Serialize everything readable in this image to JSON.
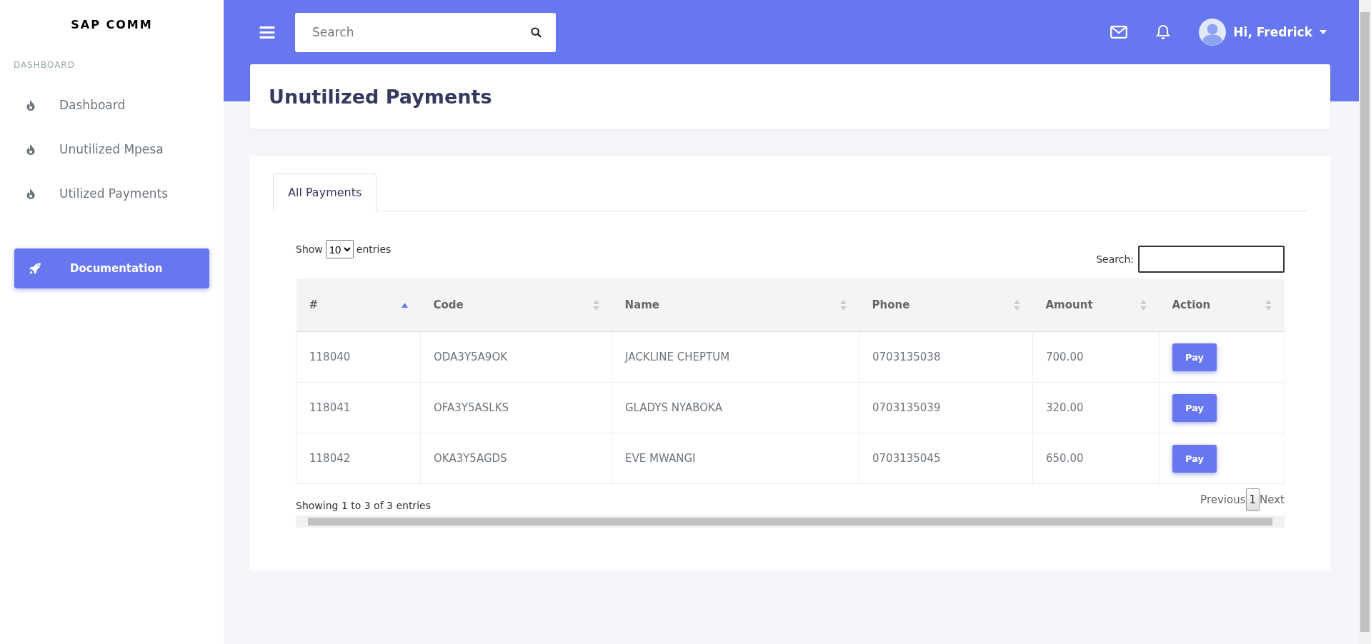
{
  "sidebar": {
    "brand": "SAP COMM",
    "section": "DASHBOARD",
    "items": [
      {
        "label": "Dashboard"
      },
      {
        "label": "Unutilized Mpesa"
      },
      {
        "label": "Utilized Payments"
      }
    ],
    "button": "Documentation"
  },
  "header": {
    "search": {
      "placeholder": "Search"
    },
    "user": "Hi, Fredrick"
  },
  "page": {
    "title": "Unutilized Payments"
  },
  "tabs": [
    {
      "label": "All Payments",
      "selected": true
    }
  ],
  "table_controls": {
    "show": "Show",
    "page_size": "10",
    "entries": "entries",
    "search_label": "Search:"
  },
  "table": {
    "columns": [
      {
        "label": "#",
        "sorted": true
      },
      {
        "label": "Code",
        "sorted": false
      },
      {
        "label": "Name",
        "sorted": false
      },
      {
        "label": "Phone",
        "sorted": false
      },
      {
        "label": "Amount",
        "sorted": false
      },
      {
        "label": "Action",
        "sorted": false
      }
    ],
    "rows": [
      {
        "id": "118040",
        "code": "ODA3Y5A9OK",
        "name": "JACKLINE CHEPTUM",
        "phone": "0703135038",
        "amount": "700.00",
        "action": "Pay"
      },
      {
        "id": "118041",
        "code": "OFA3Y5ASLKS",
        "name": "GLADYS NYABOKA",
        "phone": "0703135039",
        "amount": "320.00",
        "action": "Pay"
      },
      {
        "id": "118042",
        "code": "OKA3Y5AGDS",
        "name": "EVE MWANGI",
        "phone": "0703135045",
        "amount": "650.00",
        "action": "Pay"
      }
    ]
  },
  "footer": {
    "info": "Showing 1 to 3 of 3 entries",
    "previous": "Previous",
    "pages": [
      {
        "label": "1",
        "selected": true
      }
    ],
    "next": "Next"
  }
}
